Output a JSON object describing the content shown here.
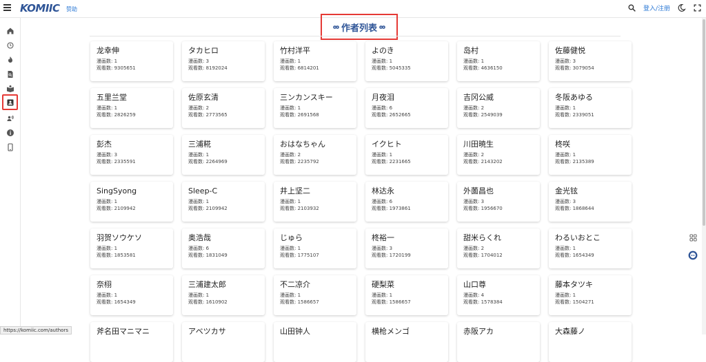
{
  "header": {
    "logo_text": "KOMIIC",
    "sponsor_label": "赞助",
    "login_label": "登入/注册"
  },
  "sidebar": {
    "items": [
      {
        "icon": "home-icon"
      },
      {
        "icon": "history-icon"
      },
      {
        "icon": "fire-icon"
      },
      {
        "icon": "document-search-icon"
      },
      {
        "icon": "book-icon"
      },
      {
        "icon": "author-card-icon",
        "active": true
      },
      {
        "icon": "podcast-icon"
      },
      {
        "icon": "info-icon"
      },
      {
        "icon": "phone-icon"
      }
    ]
  },
  "page": {
    "title": "作者列表"
  },
  "authors": [
    {
      "name": "龙幸伸",
      "count": "漫画数: 1",
      "views": "观看数: 9305651"
    },
    {
      "name": "タカヒロ",
      "count": "漫画数: 3",
      "views": "观看数: 8192024"
    },
    {
      "name": "竹村洋平",
      "count": "漫画数: 1",
      "views": "观看数: 6814201"
    },
    {
      "name": "よのき",
      "count": "漫画数: 1",
      "views": "观看数: 5045335"
    },
    {
      "name": "岛村",
      "count": "漫画数: 1",
      "views": "观看数: 4636150"
    },
    {
      "name": "佐藤健悦",
      "count": "漫画数: 3",
      "views": "观看数: 3079054"
    },
    {
      "name": "五里兰堂",
      "count": "漫画数: 1",
      "views": "观看数: 2826259"
    },
    {
      "name": "佐原玄清",
      "count": "漫画数: 2",
      "views": "观看数: 2773565"
    },
    {
      "name": "三ンカンスキー",
      "count": "漫画数: 1",
      "views": "观看数: 2691568"
    },
    {
      "name": "月夜泪",
      "count": "漫画数: 6",
      "views": "观看数: 2652665"
    },
    {
      "name": "吉冈公威",
      "count": "漫画数: 2",
      "views": "观看数: 2549039"
    },
    {
      "name": "冬阪あゆる",
      "count": "漫画数: 1",
      "views": "观看数: 2339051"
    },
    {
      "name": "彭杰",
      "count": "漫画数: 3",
      "views": "观看数: 2335591"
    },
    {
      "name": "三浦糀",
      "count": "漫画数: 1",
      "views": "观看数: 2264969"
    },
    {
      "name": "おはなちゃん",
      "count": "漫画数: 2",
      "views": "观看数: 2235792"
    },
    {
      "name": "イクヒト",
      "count": "漫画数: 1",
      "views": "观看数: 2231665"
    },
    {
      "name": "川田暁生",
      "count": "漫画数: 2",
      "views": "观看数: 2143202"
    },
    {
      "name": "柊咲",
      "count": "漫画数: 1",
      "views": "观看数: 2135389"
    },
    {
      "name": "SingSyong",
      "count": "漫画数: 1",
      "views": "观看数: 2109942"
    },
    {
      "name": "Sleep-C",
      "count": "漫画数: 1",
      "views": "观看数: 2109942"
    },
    {
      "name": "井上坚二",
      "count": "漫画数: 1",
      "views": "观看数: 2103932"
    },
    {
      "name": "林达永",
      "count": "漫画数: 6",
      "views": "观看数: 1973861"
    },
    {
      "name": "外薗昌也",
      "count": "漫画数: 3",
      "views": "观看数: 1956670"
    },
    {
      "name": "金光铉",
      "count": "漫画数: 3",
      "views": "观看数: 1868644"
    },
    {
      "name": "羽贺ソウケソ",
      "count": "漫画数: 1",
      "views": "观看数: 1853581"
    },
    {
      "name": "奥浩哉",
      "count": "漫画数: 6",
      "views": "观看数: 1831049"
    },
    {
      "name": "じゅら",
      "count": "漫画数: 1",
      "views": "观看数: 1775107"
    },
    {
      "name": "柊裕一",
      "count": "漫画数: 3",
      "views": "观看数: 1720199"
    },
    {
      "name": "甜米らくれ",
      "count": "漫画数: 2",
      "views": "观看数: 1704012"
    },
    {
      "name": "わるいおとこ",
      "count": "漫画数: 1",
      "views": "观看数: 1654349"
    },
    {
      "name": "奈栩",
      "count": "漫画数: 1",
      "views": "观看数: 1654349"
    },
    {
      "name": "三浦建太郎",
      "count": "漫画数: 1",
      "views": "观看数: 1610902"
    },
    {
      "name": "不二凉介",
      "count": "漫画数: 1",
      "views": "观看数: 1586657"
    },
    {
      "name": "硬梨菜",
      "count": "漫画数: 1",
      "views": "观看数: 1586657"
    },
    {
      "name": "山口尊",
      "count": "漫画数: 4",
      "views": "观看数: 1578384"
    },
    {
      "name": "藤本タツキ",
      "count": "漫画数: 1",
      "views": "观看数: 1504271"
    },
    {
      "name": "斧名田マニマニ",
      "count": "",
      "views": ""
    },
    {
      "name": "アベツカサ",
      "count": "",
      "views": ""
    },
    {
      "name": "山田钟人",
      "count": "",
      "views": ""
    },
    {
      "name": "横枪メンゴ",
      "count": "",
      "views": ""
    },
    {
      "name": "赤阪アカ",
      "count": "",
      "views": ""
    },
    {
      "name": "大森藤ノ",
      "count": "",
      "views": ""
    }
  ],
  "status_bar": {
    "url": "https://komiic.com/authors"
  },
  "colors": {
    "brand": "#2f5597",
    "link": "#2f7bd6",
    "highlight": "#e53935"
  }
}
